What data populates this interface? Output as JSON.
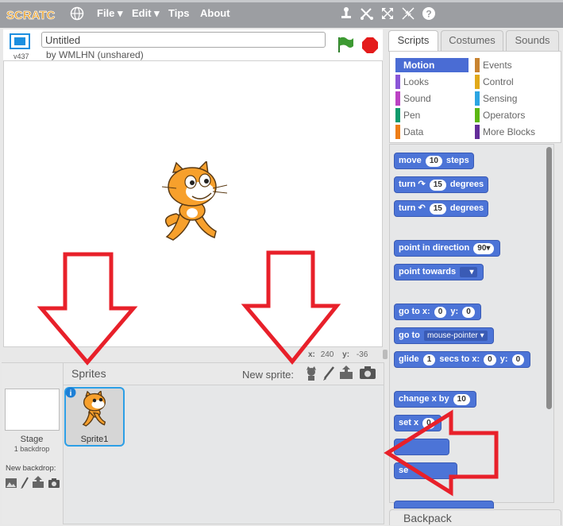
{
  "topbar": {
    "logo": "SCRATCH",
    "menu": [
      "File",
      "Edit",
      "Tips",
      "About"
    ],
    "globe_icon": "globe-icon",
    "tools": [
      "stamp-icon",
      "cut-icon",
      "grow-icon",
      "shrink-icon",
      "help-icon"
    ]
  },
  "stage": {
    "version": "v437",
    "title": "Untitled",
    "author": "by WMLHN (unshared)",
    "x_label": "x:",
    "x_value": "240",
    "y_label": "y:",
    "y_value": "-36"
  },
  "sprites_panel": {
    "header": "Sprites",
    "new_sprite_label": "New sprite:",
    "stage_label": "Stage",
    "backdrop_count": "1 backdrop",
    "new_backdrop_label": "New backdrop:",
    "sprites": [
      {
        "name": "Sprite1"
      }
    ]
  },
  "tabs": [
    "Scripts",
    "Costumes",
    "Sounds"
  ],
  "categories": {
    "left": [
      {
        "label": "Motion",
        "color": "#4a6cd4",
        "active": true
      },
      {
        "label": "Looks",
        "color": "#8a55d7"
      },
      {
        "label": "Sound",
        "color": "#bb42c3"
      },
      {
        "label": "Pen",
        "color": "#0e9a6c"
      },
      {
        "label": "Data",
        "color": "#ee7d16"
      }
    ],
    "right": [
      {
        "label": "Events",
        "color": "#c88330"
      },
      {
        "label": "Control",
        "color": "#e1a91a"
      },
      {
        "label": "Sensing",
        "color": "#2ca5e2"
      },
      {
        "label": "Operators",
        "color": "#5cb712"
      },
      {
        "label": "More Blocks",
        "color": "#632d99"
      }
    ]
  },
  "blocks": {
    "move": {
      "pre": "move",
      "value": "10",
      "post": "steps"
    },
    "turn_cw": {
      "pre": "turn",
      "value": "15",
      "post": "degrees"
    },
    "turn_ccw": {
      "pre": "turn",
      "value": "15",
      "post": "degrees"
    },
    "point_dir": {
      "pre": "point in direction",
      "value": "90"
    },
    "point_towards": {
      "pre": "point towards"
    },
    "goto_xy": {
      "pre": "go to x:",
      "x": "0",
      "mid": "y:",
      "y": "0"
    },
    "goto": {
      "pre": "go to",
      "value": "mouse-pointer"
    },
    "glide": {
      "pre": "glide",
      "value": "1",
      "mid": "secs to x:",
      "x": "0",
      "mid2": "y:",
      "y": "0"
    },
    "change_x": {
      "pre": "change x by",
      "value": "10"
    },
    "set_x": {
      "pre": "set x",
      "value": "0"
    },
    "se": {
      "pre": "se"
    }
  },
  "backpack": "Backpack",
  "colors": {
    "accent": "#4c74d7",
    "annotation": "#e8202a",
    "topbar": "#9c9ea2"
  }
}
